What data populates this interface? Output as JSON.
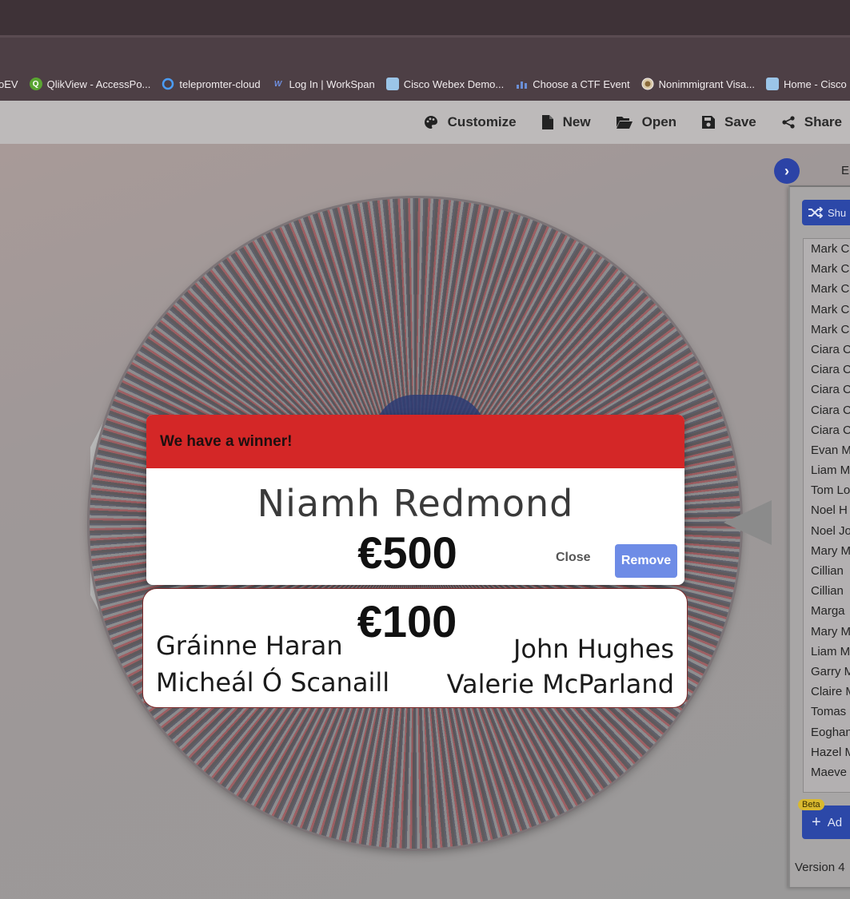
{
  "bookmarks": [
    {
      "label": "oEV",
      "icon": "none",
      "color": ""
    },
    {
      "label": "QlikView - AccessPo...",
      "icon": "qlikview-icon",
      "color": "#5aa531"
    },
    {
      "label": "telepromter-cloud",
      "icon": "circle-icon",
      "color": "#1a73e8"
    },
    {
      "label": "Log In | WorkSpan",
      "icon": "workspan-icon",
      "color": "#2b4c9b"
    },
    {
      "label": "Cisco Webex Demo...",
      "icon": "cisco-icon",
      "color": "#9bc5e8"
    },
    {
      "label": "Choose a CTF Event",
      "icon": "bars-icon",
      "color": "#6b8fd6"
    },
    {
      "label": "Nonimmigrant Visa...",
      "icon": "seal-icon",
      "color": "#d9c9a8"
    },
    {
      "label": "Home - Cisco L",
      "icon": "cisco-icon",
      "color": "#9bc5e8"
    }
  ],
  "toolbar": {
    "customize": "Customize",
    "new": "New",
    "open": "Open",
    "save": "Save",
    "share": "Share"
  },
  "panel": {
    "tab_label": "E",
    "shuffle_label": "Shu",
    "add_label": "Ad",
    "beta_label": "Beta",
    "version_label": "Version 4",
    "names": [
      "Mark C",
      "Mark C",
      "Mark C",
      "Mark C",
      "Mark C",
      "Ciara C",
      "Ciara C",
      "Ciara C",
      "Ciara C",
      "Ciara C",
      "Evan M",
      "Liam M",
      "Tom Lo",
      "Noel H",
      "Noel Jo",
      "Mary M",
      "Cillian",
      "Cillian",
      "Marga",
      "Mary M",
      "Liam M",
      "Garry M",
      "Claire M",
      "Tomas",
      "Eoghan",
      "Hazel M",
      "Maeve"
    ]
  },
  "modal": {
    "header": "We have a winner!",
    "winner": "Niamh Redmond",
    "prize": "€500",
    "close_label": "Close",
    "remove_label": "Remove"
  },
  "card100": {
    "prize": "€100",
    "winners": [
      "Gráinne Haran",
      "John Hughes",
      "Micheál Ó Scanaill",
      "Valerie McParland"
    ]
  }
}
